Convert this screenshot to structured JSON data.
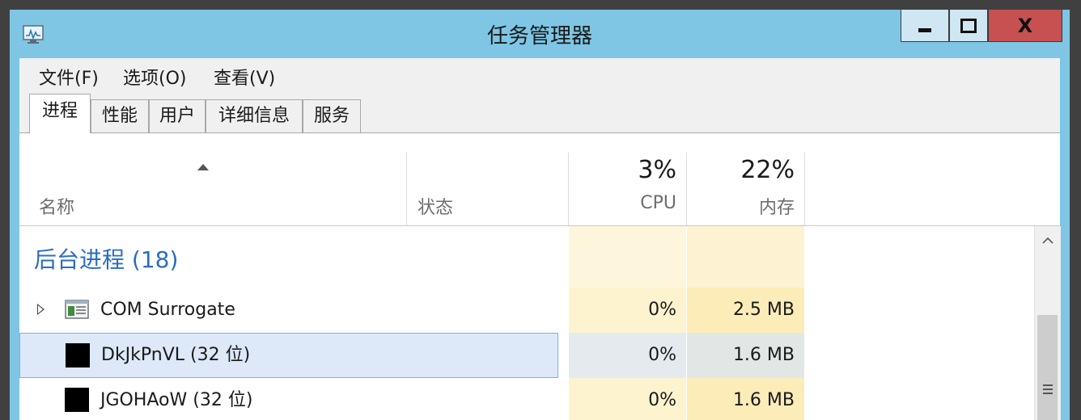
{
  "window": {
    "title": "任务管理器"
  },
  "menu": [
    "文件(F)",
    "选项(O)",
    "查看(V)"
  ],
  "tabs": [
    "进程",
    "性能",
    "用户",
    "详细信息",
    "服务"
  ],
  "active_tab": "进程",
  "columns": {
    "name": "名称",
    "status": "状态",
    "cpu": {
      "label": "CPU",
      "usage": "3%"
    },
    "memory": {
      "label": "内存",
      "usage": "22%"
    }
  },
  "group": {
    "label": "后台进程 (18)"
  },
  "processes": [
    {
      "name": "COM Surrogate",
      "cpu": "0%",
      "memory": "2.5 MB",
      "icon": "window-app-icon",
      "expandable": true,
      "selected": false
    },
    {
      "name": "DkJkPnVL (32 位)",
      "cpu": "0%",
      "memory": "1.6 MB",
      "icon": "black-square-icon",
      "expandable": false,
      "selected": true
    },
    {
      "name": "JGOHAoW (32 位)",
      "cpu": "0%",
      "memory": "1.6 MB",
      "icon": "black-square-icon",
      "expandable": false,
      "selected": false
    }
  ],
  "colors": {
    "titlebar": "#7ec6e4",
    "close_button": "#c75050",
    "group_label": "#2b6cc4",
    "cpu_heat": "#fdf2c4",
    "memory_heat": "#fbeab0",
    "selection": "#dde9f8"
  }
}
